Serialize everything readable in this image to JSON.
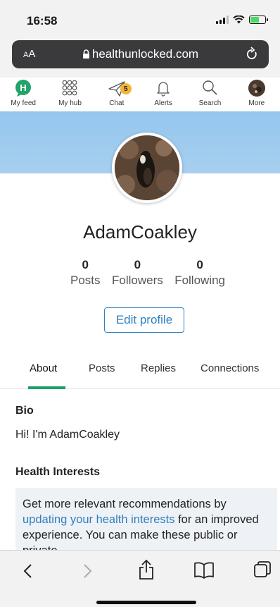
{
  "status": {
    "time": "16:58"
  },
  "browser": {
    "aa_small": "A",
    "aa_big": "A",
    "url": "healthunlocked.com",
    "lock_icon": "lock-icon",
    "reload_icon": "reload-icon"
  },
  "nav": {
    "items": [
      {
        "label": "My feed",
        "icon": "healthunlocked-logo-icon"
      },
      {
        "label": "My hub",
        "icon": "grid-icon"
      },
      {
        "label": "Chat",
        "icon": "paper-plane-icon",
        "badge": "5"
      },
      {
        "label": "Alerts",
        "icon": "bell-icon"
      },
      {
        "label": "Search",
        "icon": "search-icon"
      },
      {
        "label": "More",
        "icon": "avatar-icon"
      }
    ]
  },
  "profile": {
    "username": "AdamCoakley",
    "stats": [
      {
        "value": "0",
        "label": "Posts"
      },
      {
        "value": "0",
        "label": "Followers"
      },
      {
        "value": "0",
        "label": "Following"
      }
    ],
    "edit_label": "Edit profile",
    "tabs": [
      "About",
      "Posts",
      "Replies",
      "Connections"
    ],
    "bio_title": "Bio",
    "bio_text": "Hi! I'm AdamCoakley",
    "interests_title": "Health Interests",
    "interests_pre": "Get more relevant recommendations by ",
    "interests_link": "updating your health interests",
    "interests_post": " for an improved experience. You can make these public or private."
  },
  "colors": {
    "accent": "#2f7fbf",
    "tab_underline": "#1d9f6c",
    "brand_green": "#22a36a",
    "badge": "#f4b435"
  }
}
